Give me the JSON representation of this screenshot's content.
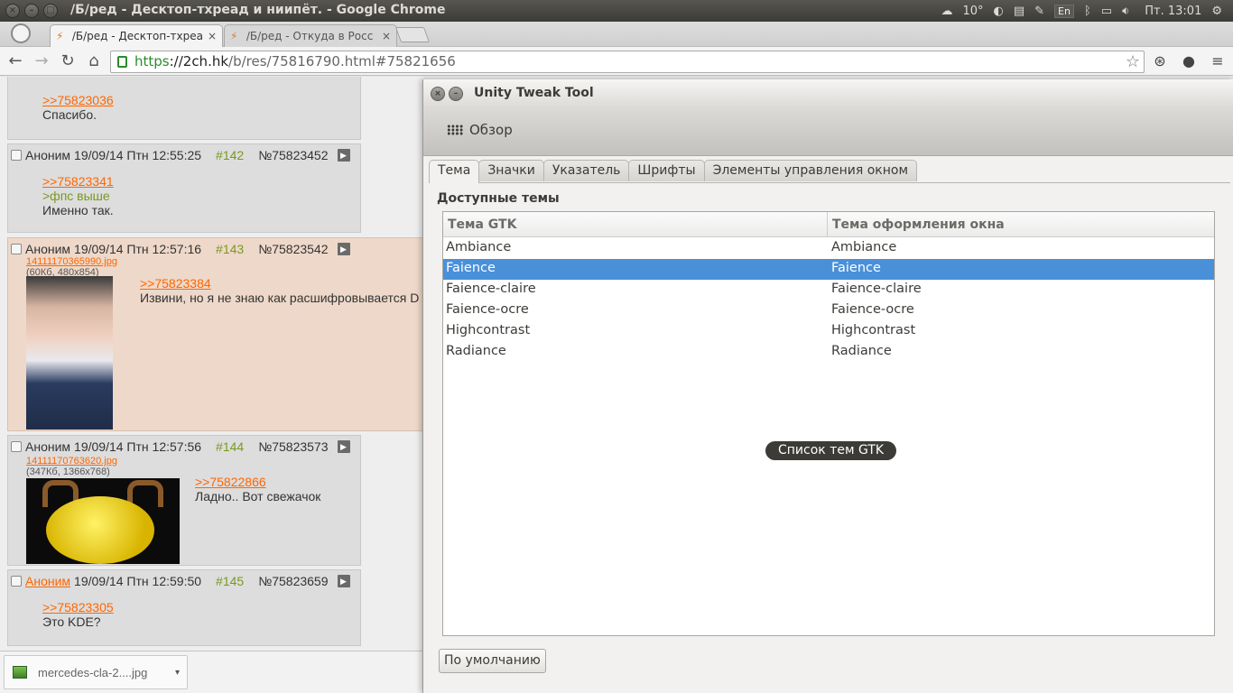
{
  "top_panel": {
    "window_title": "/Б/ред - Десктоп-тхреад и ниипёт. - Google Chrome",
    "weather_temp": "10°",
    "keyboard_layout": "En",
    "clock": "Пт. 13:01"
  },
  "browser": {
    "tabs": [
      {
        "title": "/Б/ред - Десктоп-тхреад",
        "close": "×"
      },
      {
        "title": "/Б/ред - Откуда в Росс",
        "close": "×"
      }
    ],
    "url": {
      "scheme": "https",
      "host": "://2ch.hk",
      "path": "/b/res/75816790.html#75821656"
    }
  },
  "posts": [
    {
      "lines": [
        {
          "text": ">>75823036",
          "kind": "link"
        },
        {
          "text": "Спасибо.",
          "kind": "text"
        }
      ]
    },
    {
      "name": "Аноним",
      "date": "19/09/14 Птн 12:55:25",
      "num": "#142",
      "id": "№75823452",
      "lines": [
        {
          "text": ">>75823341",
          "kind": "link"
        },
        {
          "text": ">фпс выше",
          "kind": "green"
        },
        {
          "text": "Именно так.",
          "kind": "text"
        }
      ]
    },
    {
      "name": "Аноним",
      "date": "19/09/14 Птн 12:57:16",
      "num": "#143",
      "id": "№75823542",
      "file": "14111170365990.jpg",
      "file_meta": "(60Кб, 480x854)",
      "lines": [
        {
          "text": ">>75823384",
          "kind": "link"
        },
        {
          "text": "Извини, но я не знаю как расшифровывается D",
          "kind": "text"
        }
      ]
    },
    {
      "name": "Аноним",
      "date": "19/09/14 Птн 12:57:56",
      "num": "#144",
      "id": "№75823573",
      "file": "14111170763620.jpg",
      "file_meta": "(347Кб, 1366x768)",
      "lines": [
        {
          "text": ">>75822866",
          "kind": "link"
        },
        {
          "text": "Ладно.. Вот свежачок",
          "kind": "text"
        }
      ]
    },
    {
      "name": "Аноним",
      "date": "19/09/14 Птн 12:59:50",
      "num": "#145",
      "id": "№75823659",
      "lines": [
        {
          "text": ">>75823305",
          "kind": "link"
        },
        {
          "text": "Это KDE?",
          "kind": "text"
        }
      ]
    }
  ],
  "download": {
    "filename": "mercedes-cla-2....jpg"
  },
  "utt": {
    "title": "Unity Tweak Tool",
    "overview": "Обзор",
    "tabs": [
      "Тема",
      "Значки",
      "Указатель",
      "Шрифты",
      "Элементы управления окном"
    ],
    "active_tab": "Тема",
    "section_title": "Доступные темы",
    "columns": [
      "Тема GTK",
      "Тема оформления окна"
    ],
    "rows": [
      {
        "gtk": "Ambiance",
        "window": "Ambiance"
      },
      {
        "gtk": "Faience",
        "window": "Faience",
        "selected": true
      },
      {
        "gtk": "Faience-claire",
        "window": "Faience-claire"
      },
      {
        "gtk": "Faience-ocre",
        "window": "Faience-ocre"
      },
      {
        "gtk": "Highcontrast",
        "window": "Highcontrast"
      },
      {
        "gtk": "Radiance",
        "window": "Radiance"
      }
    ],
    "tooltip": "Список тем GTK",
    "default_button": "По умолчанию"
  },
  "colors": {
    "selection": "#4a90d9",
    "link": "#ff6600",
    "greentext": "#789922"
  }
}
